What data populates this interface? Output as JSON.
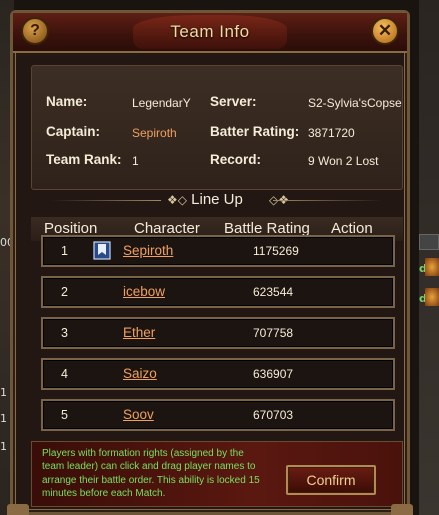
{
  "window": {
    "title": "Team Info",
    "help_icon": "?",
    "close_icon": "✕"
  },
  "info": {
    "name_label": "Name:",
    "name_value": "LegendarY",
    "server_label": "Server:",
    "server_value": "S2-Sylvia'sCopse",
    "captain_label": "Captain:",
    "captain_value": "Sepiroth",
    "batter_label": "Batter Rating:",
    "batter_value": "3871720",
    "rank_label": "Team Rank:",
    "rank_value": "1",
    "record_label": "Record:",
    "record_value": "9 Won 2 Lost"
  },
  "lineup": {
    "heading": "Line Up",
    "columns": {
      "position": "Position",
      "character": "Character",
      "battle_rating": "Battle Rating",
      "action": "Action"
    },
    "rows": [
      {
        "position": "1",
        "name": "Sepiroth",
        "rating": "1175269",
        "captain_banner": "banner-icon"
      },
      {
        "position": "2",
        "name": "icebow",
        "rating": "623544"
      },
      {
        "position": "3",
        "name": "Ether",
        "rating": "707758"
      },
      {
        "position": "4",
        "name": "Saizo",
        "rating": "636907"
      },
      {
        "position": "5",
        "name": "Soov",
        "rating": "670703"
      }
    ]
  },
  "notice": {
    "text": "Players with formation rights (assigned by the team leader) can click and drag player names to arrange their battle order. This ability is locked 15 minutes before each Match.",
    "confirm_label": "Confirm"
  },
  "background": {
    "left_numbers": [
      "00",
      "1",
      "1",
      "1"
    ],
    "right_letters": [
      "d",
      "d"
    ]
  }
}
